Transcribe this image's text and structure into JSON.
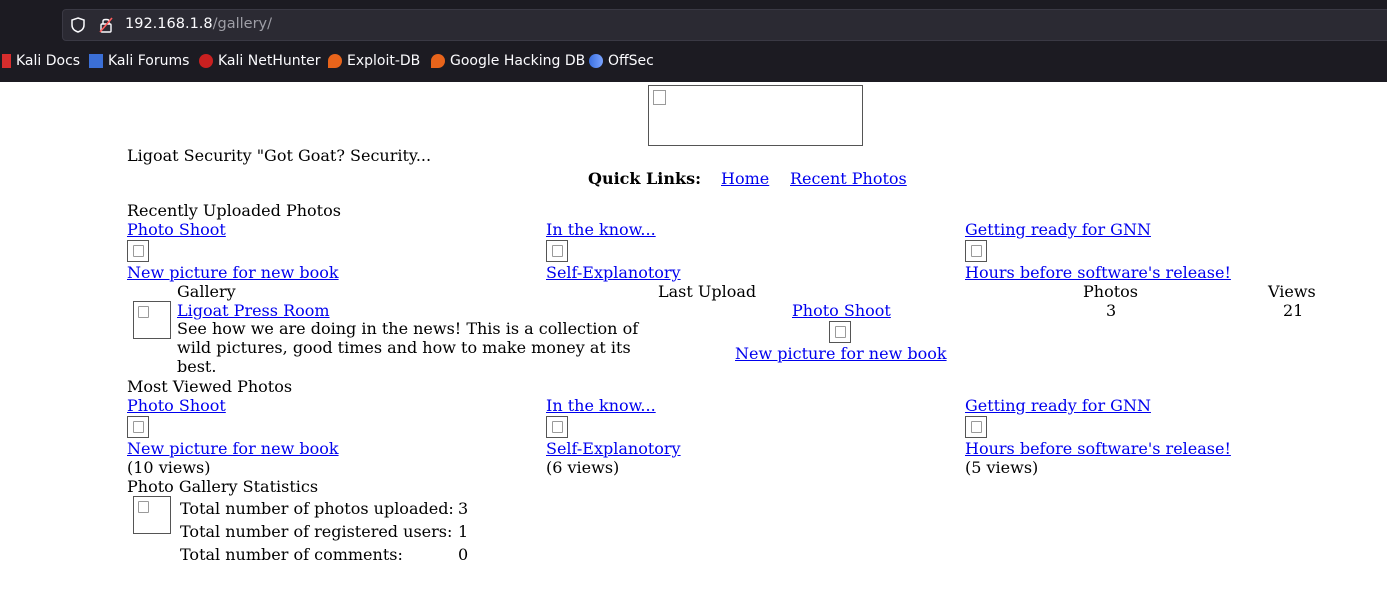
{
  "browser": {
    "url_host": "192.168.1.8",
    "url_path": "/gallery/",
    "bookmarks": [
      "Kali Docs",
      "Kali Forums",
      "Kali NetHunter",
      "Exploit-DB",
      "Google Hacking DB",
      "OffSec"
    ]
  },
  "site": {
    "tagline": "Ligoat Security \"Got Goat? Security...",
    "quick_links_label": "Quick Links:",
    "quick_links": [
      "Home",
      "Recent Photos"
    ]
  },
  "recent": {
    "heading": "Recently Uploaded Photos",
    "items": [
      {
        "album": "Photo Shoot",
        "title": "New picture for new book"
      },
      {
        "album": "In the know...",
        "title": "Self-Explanotory"
      },
      {
        "album": "Getting ready for GNN",
        "title": "Hours before software's release!"
      }
    ]
  },
  "gallery_table": {
    "headers": {
      "gallery": "Gallery",
      "last_upload": "Last Upload",
      "photos": "Photos",
      "views": "Views"
    },
    "row": {
      "name": "Ligoat Press Room",
      "description": "See how we are doing in the news! This is a collection of wild pictures, good times and how to make money at its best.",
      "last_album": "Photo Shoot",
      "last_title": "New picture for new book",
      "photos": "3",
      "views": "21"
    }
  },
  "most_viewed": {
    "heading": "Most Viewed Photos",
    "items": [
      {
        "album": "Photo Shoot",
        "title": "New picture for new book",
        "views": "(10 views)"
      },
      {
        "album": "In the know...",
        "title": "Self-Explanotory",
        "views": "(6 views)"
      },
      {
        "album": "Getting ready for GNN",
        "title": "Hours before software's release!",
        "views": "(5 views)"
      }
    ]
  },
  "stats": {
    "heading": "Photo Gallery Statistics",
    "rows": [
      {
        "label": "Total number of photos uploaded:",
        "value": "3"
      },
      {
        "label": "Total number of registered users:",
        "value": "1"
      },
      {
        "label": "Total number of comments:",
        "value": "0"
      }
    ]
  },
  "colors": {
    "link": "#0000ee",
    "chrome_bg": "#1c1b22",
    "urlbar_bg": "#2b2a33"
  }
}
